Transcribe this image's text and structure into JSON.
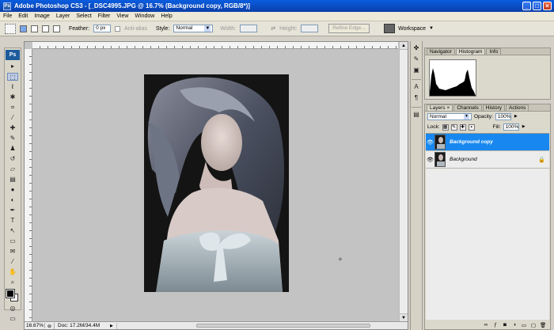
{
  "window": {
    "title": "Adobe Photoshop CS3 - [_DSC4995.JPG @ 16.7% (Background copy, RGB/8*)]",
    "app_icon": "Ps",
    "controls": [
      "_",
      "□",
      "×"
    ]
  },
  "menu": [
    "File",
    "Edit",
    "Image",
    "Layer",
    "Select",
    "Filter",
    "View",
    "Window",
    "Help"
  ],
  "options": {
    "feather_label": "Feather:",
    "feather_value": "0 px",
    "antialias_label": "Anti-alias",
    "style_label": "Style:",
    "style_value": "Normal",
    "width_label": "Width:",
    "height_label": "Height:",
    "refine_label": "Refine Edge...",
    "workspace_label": "Workspace"
  },
  "toolbox": {
    "logo": "Ps",
    "tools": [
      {
        "name": "move-tool",
        "glyph": "▸"
      },
      {
        "name": "marquee-tool",
        "glyph": "⬚",
        "selected": true
      },
      {
        "name": "lasso-tool",
        "glyph": "ℓ"
      },
      {
        "name": "magic-wand-tool",
        "glyph": "✱"
      },
      {
        "name": "crop-tool",
        "glyph": "⌗"
      },
      {
        "name": "slice-tool",
        "glyph": "⁄"
      },
      {
        "name": "healing-brush-tool",
        "glyph": "✚"
      },
      {
        "name": "brush-tool",
        "glyph": "✎"
      },
      {
        "name": "clone-stamp-tool",
        "glyph": "♟"
      },
      {
        "name": "history-brush-tool",
        "glyph": "↺"
      },
      {
        "name": "eraser-tool",
        "glyph": "▱"
      },
      {
        "name": "gradient-tool",
        "glyph": "▤"
      },
      {
        "name": "blur-tool",
        "glyph": "●"
      },
      {
        "name": "dodge-tool",
        "glyph": "◐"
      },
      {
        "name": "pen-tool",
        "glyph": "✒"
      },
      {
        "name": "type-tool",
        "glyph": "T"
      },
      {
        "name": "path-selection-tool",
        "glyph": "↖"
      },
      {
        "name": "shape-tool",
        "glyph": "▭"
      },
      {
        "name": "notes-tool",
        "glyph": "✉"
      },
      {
        "name": "eyedropper-tool",
        "glyph": "⁄"
      },
      {
        "name": "hand-tool",
        "glyph": "✋"
      },
      {
        "name": "zoom-tool",
        "glyph": "⌕"
      }
    ]
  },
  "status": {
    "zoom": "16.67%",
    "doc": "Doc: 17.2M/34.4M"
  },
  "panels": {
    "top_tabs": [
      "Navigator",
      "Histogram",
      "Info"
    ],
    "top_active": 1,
    "layers_tabs": [
      "Layers",
      "Channels",
      "History",
      "Actions"
    ],
    "layers_active": 0,
    "blend_mode": "Normal",
    "opacity_label": "Opacity:",
    "opacity_value": "100%",
    "lock_label": "Lock:",
    "fill_label": "Fill:",
    "fill_value": "100%",
    "layers": [
      {
        "name": "Background copy",
        "selected": true,
        "locked": false
      },
      {
        "name": "Background",
        "selected": false,
        "locked": true
      }
    ],
    "footer_icons": [
      "link-icon",
      "fx-icon",
      "mask-icon",
      "adjustment-icon",
      "group-icon",
      "new-layer-icon",
      "trash-icon"
    ]
  },
  "colors": {
    "titlebar": "#0a4ec8",
    "selected_layer": "#1888f0",
    "canvas_bg": "#c3c3c3"
  }
}
